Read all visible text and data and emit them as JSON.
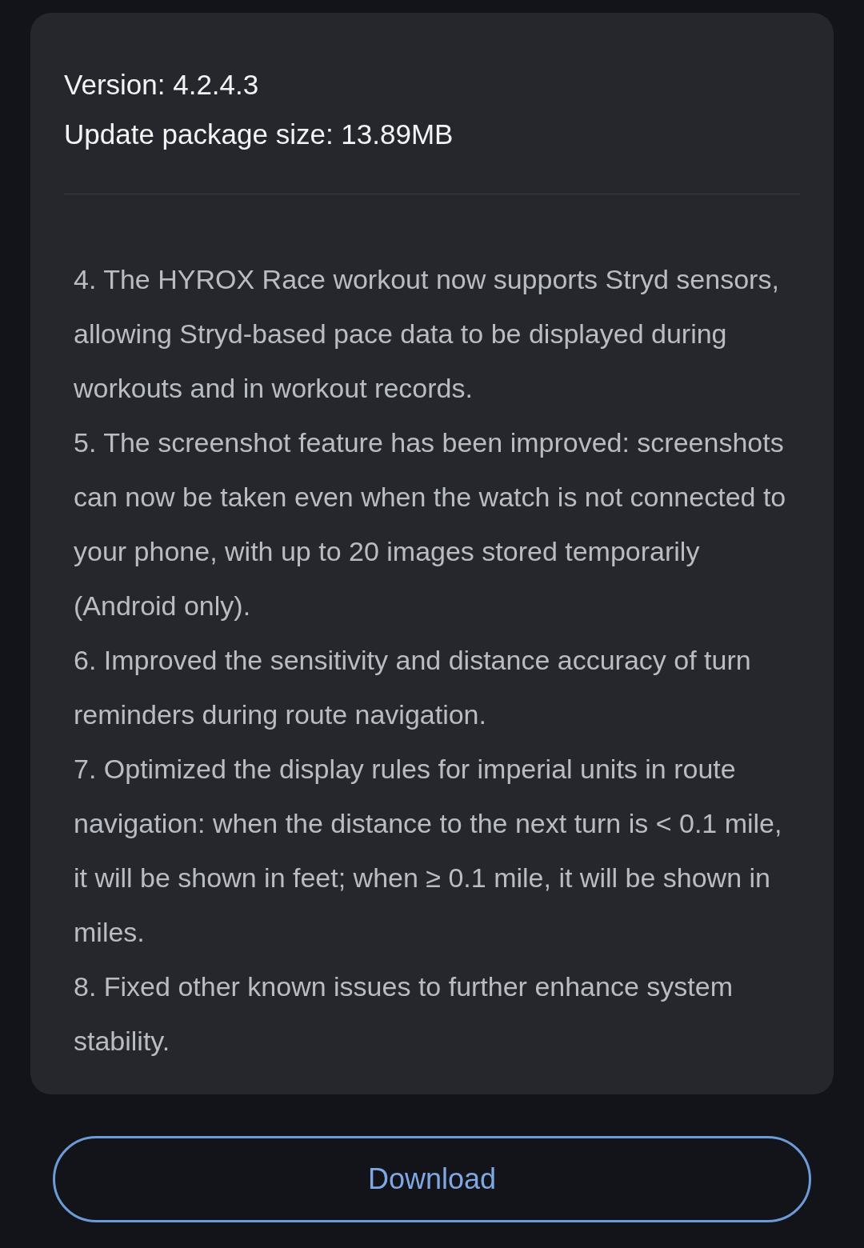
{
  "info": {
    "version": "Version: 4.2.4.3",
    "package_size": "Update package size: 13.89MB"
  },
  "release_notes": [
    "4. The HYROX Race workout now supports Stryd sensors, allowing Stryd-based pace data to be displayed during workouts and in workout records.",
    "5. The screenshot feature has been improved: screenshots can now be taken even when the watch is not connected to your phone, with up to 20 images stored temporarily (Android only).",
    "6. Improved the sensitivity and distance accuracy of turn reminders during route navigation.",
    "7. Optimized the display rules for imperial units in route navigation: when the distance to the next turn is < 0.1 mile, it will be shown in feet; when ≥ 0.1 mile, it will be shown in miles.",
    "8. Fixed other known issues to further enhance system stability."
  ],
  "download_button": {
    "label": "Download"
  }
}
